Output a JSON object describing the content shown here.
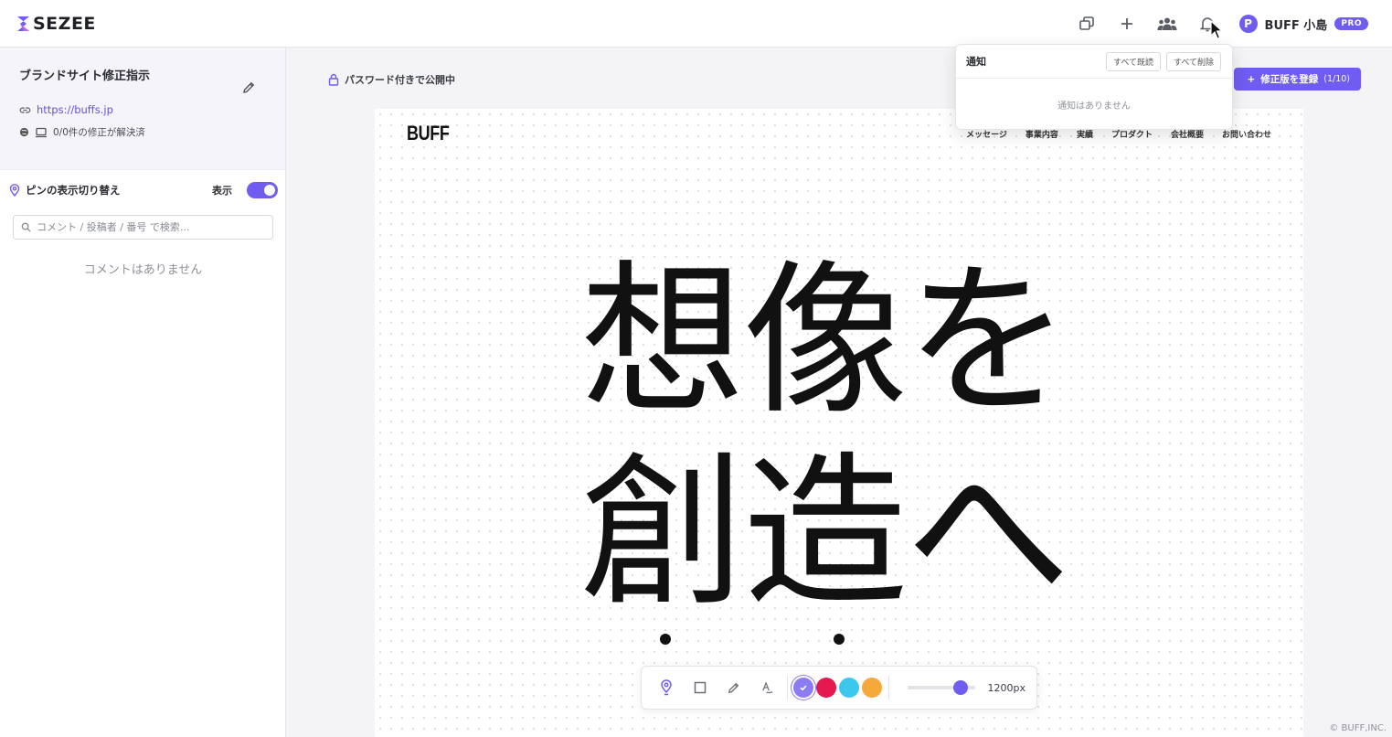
{
  "app": {
    "logo_text": "SEZEE"
  },
  "header": {
    "user_initial": "P",
    "user_name": "BUFF 小島",
    "badge": "PRO"
  },
  "sidebar": {
    "project_title": "ブランドサイト修正指示",
    "project_url": "https://buffs.jp",
    "resolved_status": "0/0件の修正が解決済",
    "pin_toggle_label": "ピンの表示切り替え",
    "pin_toggle_state": "表示",
    "search_placeholder": "コメント / 投稿者 / 番号 で検索...",
    "empty_comments": "コメントはありません"
  },
  "main": {
    "publish_status": "パスワード付きで公開中",
    "register_label": "修正版を登録",
    "register_count": "(1/10)"
  },
  "preview": {
    "logo": "BUFF",
    "nav": [
      "メッセージ",
      "事業内容",
      "実績",
      "プロダクト",
      "会社概要",
      "お問い合わせ"
    ],
    "hero_line1": "想像を",
    "hero_line2": "創造へ"
  },
  "toolbar": {
    "colors": [
      "#8c7cf2",
      "#e5194f",
      "#3cc8ee",
      "#f5a93a"
    ],
    "selected_color": "#8c7cf2",
    "width_label": "1200px",
    "slider_fraction": 0.78
  },
  "notifications": {
    "title": "通知",
    "mark_all_read": "すべて既読",
    "delete_all": "すべて削除",
    "empty": "通知はありません"
  },
  "footer": {
    "copyright": "© BUFF,INC."
  },
  "colors": {
    "accent": "#6f5cf0"
  }
}
